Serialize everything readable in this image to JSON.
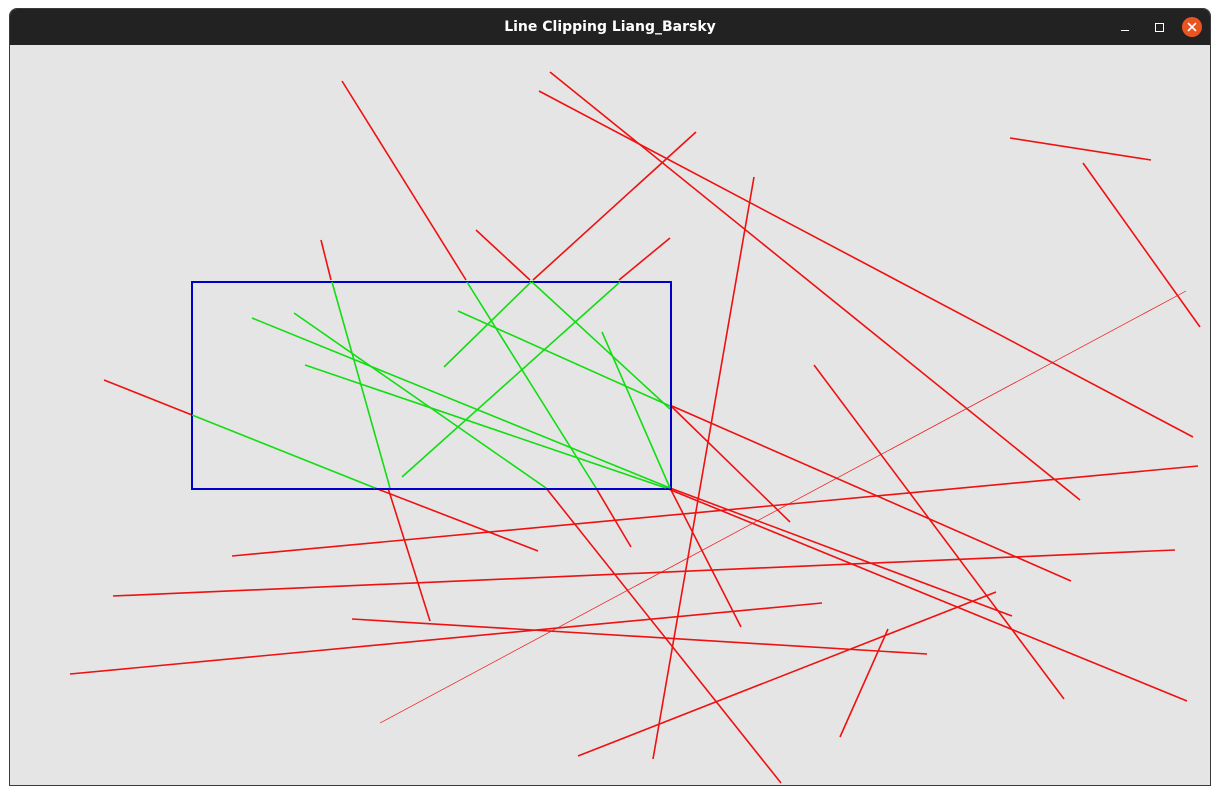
{
  "window": {
    "title": "Line Clipping Liang_Barsky",
    "controls": [
      "minimize",
      "maximize",
      "close"
    ],
    "titlebar_color": "#222222",
    "close_color": "#e95420",
    "background": "#e6e5e5"
  },
  "colors": {
    "clip_window": "#0000cc",
    "outside_line": "#ee1111",
    "inside_line": "#11dd11"
  }
}
